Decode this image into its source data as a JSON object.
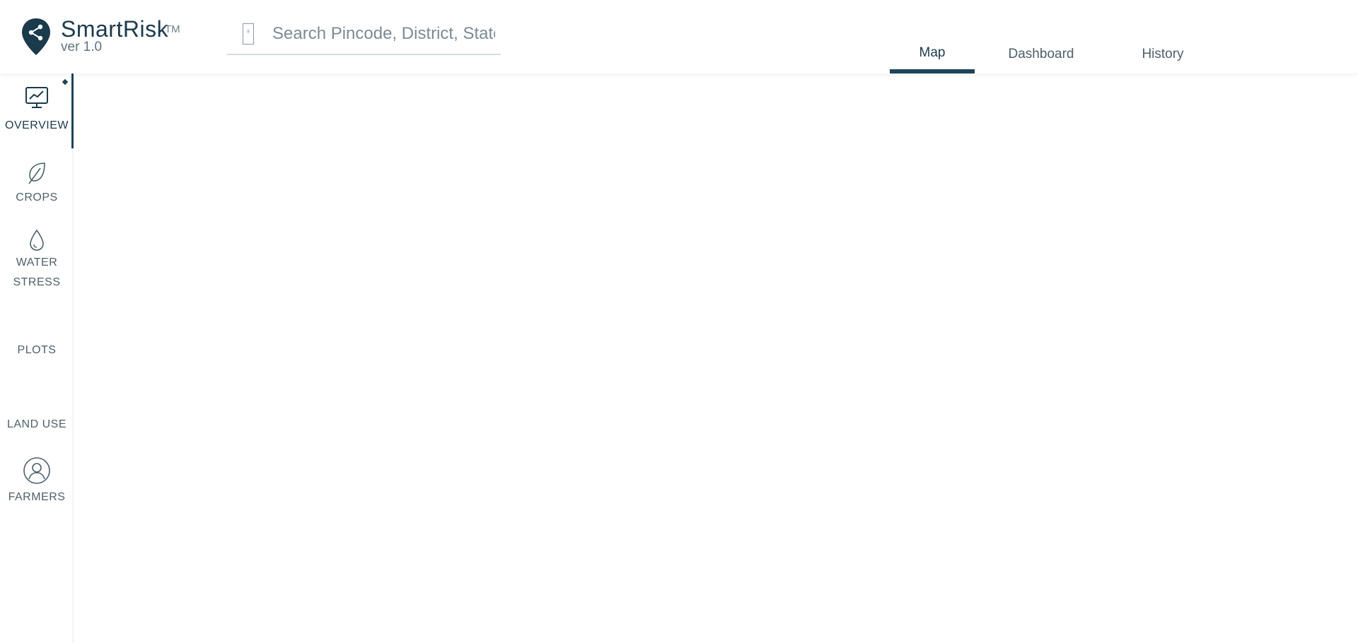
{
  "brand": {
    "name": "SmartRisk",
    "trademark": "TM",
    "version": "ver 1.0",
    "color": "#1b3a4b"
  },
  "search": {
    "placeholder": "Search Pincode, District, State",
    "value": ""
  },
  "nav": {
    "tabs": [
      {
        "label": "Map",
        "active": true
      },
      {
        "label": "Dashboard",
        "active": false
      },
      {
        "label": "History",
        "active": false
      }
    ],
    "accent": "#1e4457"
  },
  "sidebar": {
    "items": [
      {
        "label": "OVERVIEW",
        "icon": "monitor-chart-icon",
        "active": true
      },
      {
        "label": "CROPS",
        "icon": "leaf-icon",
        "active": false
      },
      {
        "label": "WATER\nSTRESS",
        "icon": "water-drop-icon",
        "active": false
      },
      {
        "label": "PLOTS",
        "icon": "",
        "active": false
      },
      {
        "label": "LAND USE",
        "icon": "",
        "active": false
      },
      {
        "label": "FARMERS",
        "icon": "user-icon",
        "active": false
      }
    ]
  }
}
